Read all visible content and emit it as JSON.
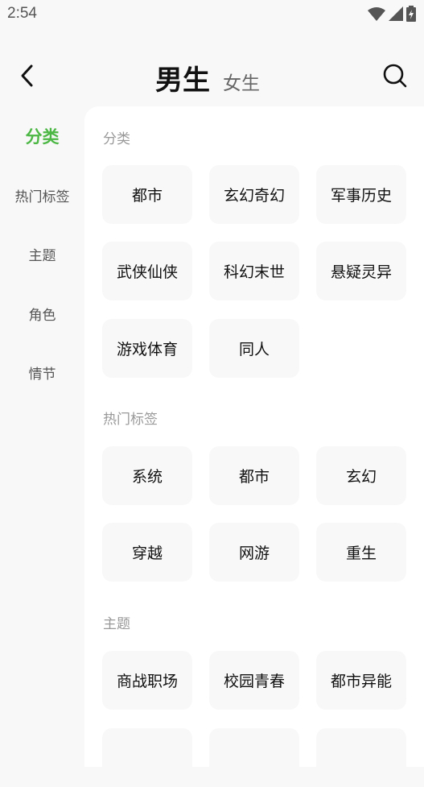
{
  "status_bar": {
    "time": "2:54",
    "icons": [
      "wifi-icon",
      "signal-icon",
      "battery-charging-icon"
    ]
  },
  "header": {
    "back_icon": "chevron-left-icon",
    "tabs": [
      {
        "label": "男生",
        "active": true
      },
      {
        "label": "女生",
        "active": false
      }
    ],
    "search_icon": "search-icon"
  },
  "colors": {
    "accent": "#4cb744",
    "chip_bg": "#f8f8f8",
    "page_bg": "#f8f8f8"
  },
  "sidebar": {
    "items": [
      {
        "label": "分类",
        "active": true
      },
      {
        "label": "热门标签",
        "active": false
      },
      {
        "label": "主题",
        "active": false
      },
      {
        "label": "角色",
        "active": false
      },
      {
        "label": "情节",
        "active": false
      }
    ]
  },
  "sections": [
    {
      "title": "分类",
      "items": [
        "都市",
        "玄幻奇幻",
        "军事历史",
        "武侠仙侠",
        "科幻末世",
        "悬疑灵异",
        "游戏体育",
        "同人"
      ]
    },
    {
      "title": "热门标签",
      "items": [
        "系统",
        "都市",
        "玄幻",
        "穿越",
        "网游",
        "重生"
      ]
    },
    {
      "title": "主题",
      "items": [
        "商战职场",
        "校园青春",
        "都市异能",
        "",
        "",
        ""
      ]
    }
  ]
}
